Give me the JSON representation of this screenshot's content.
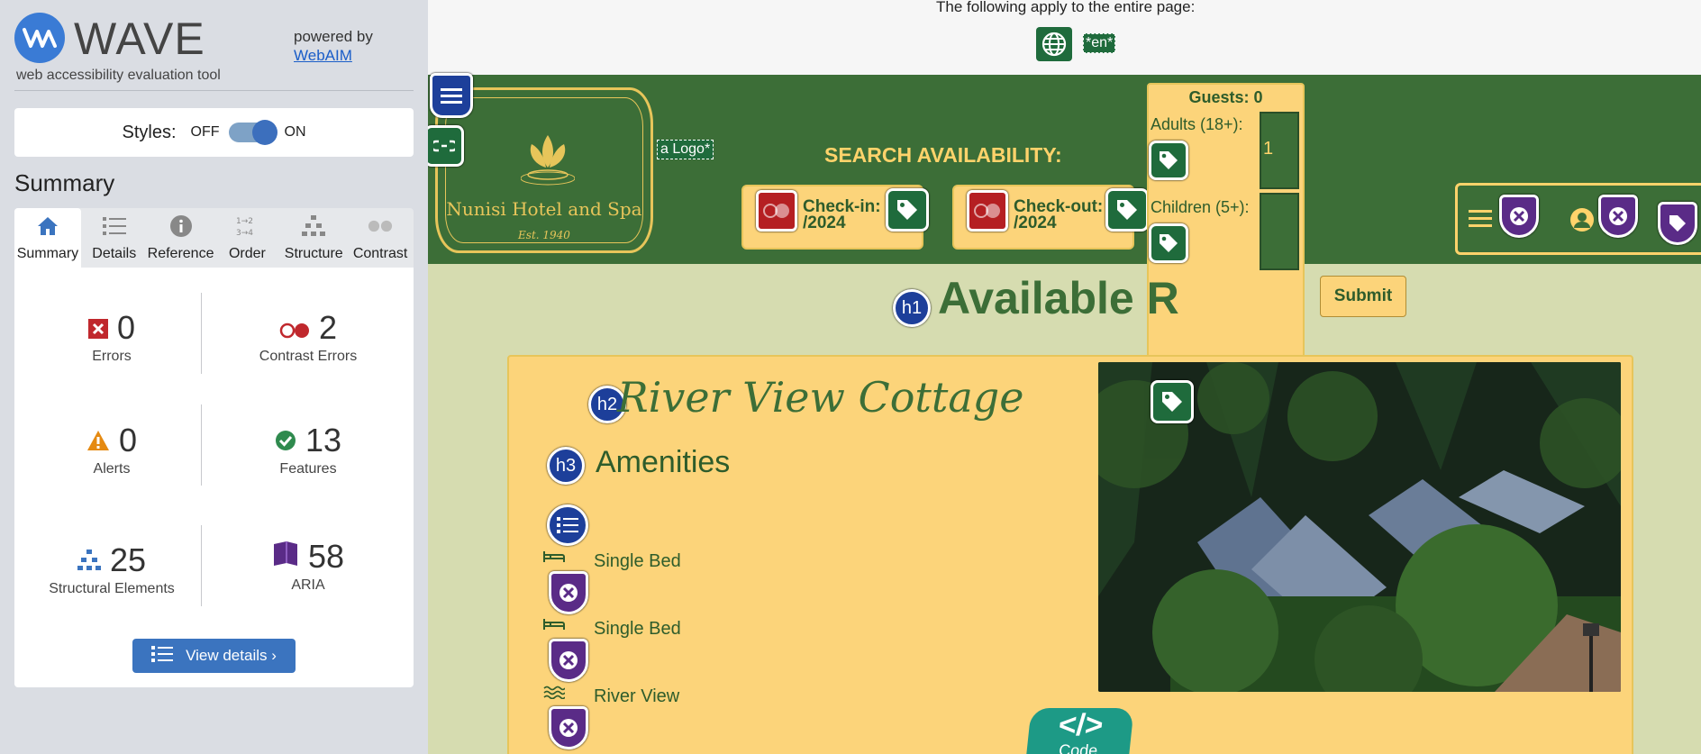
{
  "wave": {
    "title": "WAVE",
    "subtitle": "web accessibility evaluation tool",
    "powered_by": "powered by",
    "webaim_link": "WebAIM",
    "styles_label": "Styles:",
    "styles_off": "OFF",
    "styles_on": "ON",
    "styles_state": "on",
    "summary_title": "Summary",
    "tabs": [
      {
        "label": "Summary",
        "icon": "home-icon",
        "active": true
      },
      {
        "label": "Details",
        "icon": "list-icon"
      },
      {
        "label": "Reference",
        "icon": "info-icon"
      },
      {
        "label": "Order",
        "icon": "order-icon"
      },
      {
        "label": "Structure",
        "icon": "structure-icon"
      },
      {
        "label": "Contrast",
        "icon": "contrast-icon"
      }
    ],
    "stats": {
      "errors": {
        "value": "0",
        "label": "Errors",
        "color": "#c0282d"
      },
      "contrast_errors": {
        "value": "2",
        "label": "Contrast Errors",
        "color": "#c0282d"
      },
      "alerts": {
        "value": "0",
        "label": "Alerts",
        "color": "#e58a12"
      },
      "features": {
        "value": "13",
        "label": "Features",
        "color": "#2f8a4e"
      },
      "structural": {
        "value": "25",
        "label": "Structural Elements",
        "color": "#3b74bf"
      },
      "aria": {
        "value": "58",
        "label": "ARIA",
        "color": "#5a2b87"
      }
    },
    "view_details": "View details ›"
  },
  "page": {
    "applies_text": "The following apply to the entire page:",
    "lang_tag": "*en*",
    "logo_tag": "a Logo*",
    "hotel_name": "Nunisi Hotel and Spa",
    "hotel_est": "Est. 1940",
    "search_label": "SEARCH AVAILABILITY:",
    "checkin_label": "Check-in:",
    "checkin_value": "/2024",
    "checkout_label": "Check-out:",
    "checkout_value": "/2024",
    "guests_label": "Guests: 0",
    "adults_label": "Adults (18+):",
    "adults_value": "1",
    "children_label": "Children (5+):",
    "submit_label": "Submit",
    "available_heading": "Available R",
    "h1": "h1",
    "h2": "h2",
    "h3": "h3",
    "cottage_title": "River View Cottage",
    "amenities_title": "Amenities",
    "amenities": [
      "Single Bed",
      "Single Bed",
      "River View"
    ],
    "code_button_symbol": "</>",
    "code_button_label": "Code",
    "colors": {
      "green": "#3c6e37",
      "gold": "#fcd47a",
      "accent_gold": "#ffd36b"
    }
  }
}
